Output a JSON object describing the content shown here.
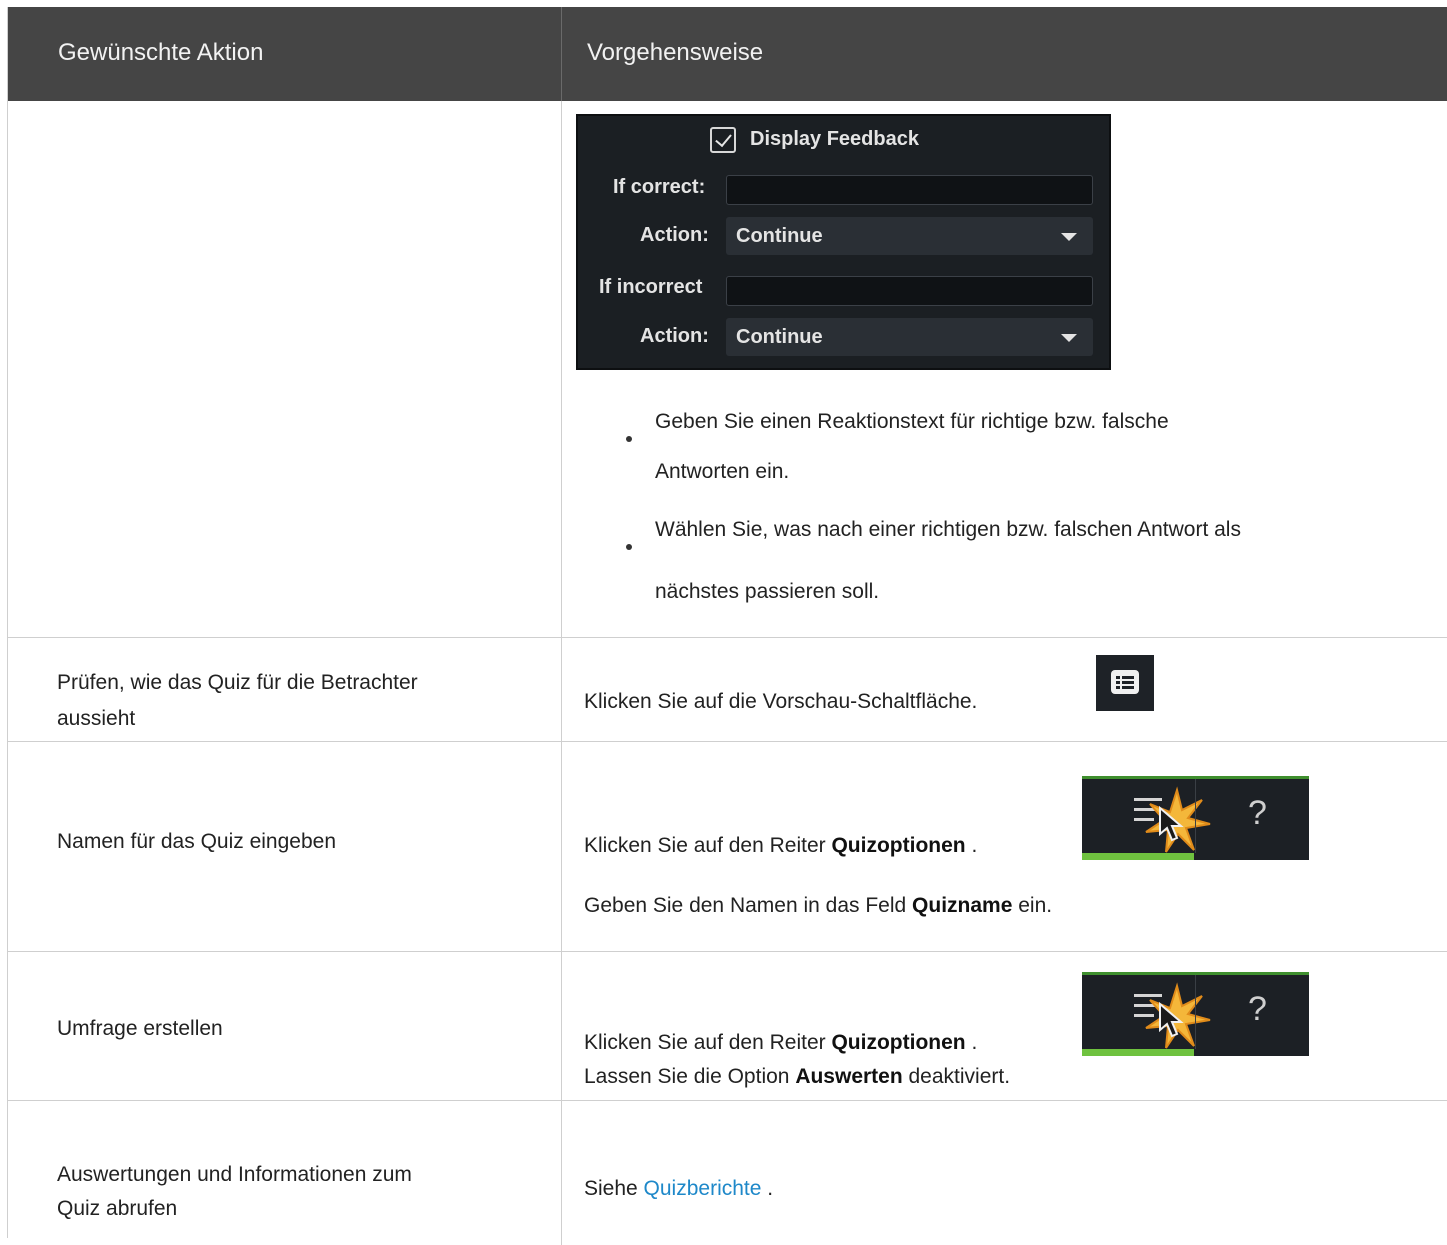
{
  "header": {
    "col1": "Gewünschte Aktion",
    "col2": "Vorgehensweise"
  },
  "feedback_panel": {
    "checkbox_label": "Display Feedback",
    "if_correct_label": "If correct:",
    "action1_label": "Action:",
    "action1_value": "Continue",
    "if_incorrect_label": "If incorrect",
    "action2_label": "Action:",
    "action2_value": "Continue"
  },
  "rows": [
    {
      "bullet1_line1": "Geben Sie einen Reaktionstext für richtige bzw. falsche",
      "bullet1_line2": "Antworten ein.",
      "bullet2_line1": "Wählen Sie, was nach einer richtigen bzw. falschen Antwort als",
      "bullet2_line2": "nächstes passieren soll."
    },
    {
      "action_line1": "Prüfen, wie das Quiz für die Betrachter",
      "action_line2": "aussieht",
      "step": "Klicken Sie auf die Vorschau-Schaltfläche."
    },
    {
      "action": "Namen für das Quiz eingeben",
      "step1_pre": "Klicken Sie auf den Reiter ",
      "step1_bold": "Quizoptionen",
      "step1_post": " .",
      "step2_pre": "Geben Sie den Namen in das Feld ",
      "step2_bold": "Quizname",
      "step2_post": " ein."
    },
    {
      "action": "Umfrage erstellen",
      "step1_pre": "Klicken Sie auf den Reiter ",
      "step1_bold": "Quizoptionen",
      "step1_post": " .",
      "step2_pre": "Lassen Sie die Option ",
      "step2_bold": "Auswerten",
      "step2_post": " deaktiviert."
    },
    {
      "action_line1": "Auswertungen und Informationen zum",
      "action_line2": "Quiz abrufen",
      "step_pre": "Siehe ",
      "step_link": "Quizberichte",
      "step_post": " ."
    }
  ],
  "icons": {
    "preview": "preview-list-icon",
    "quiz_options_tab": "menu-lines-icon",
    "help_tab": "question-mark-icon",
    "cursor": "mouse-pointer-icon",
    "click_burst": "click-starburst-icon"
  }
}
